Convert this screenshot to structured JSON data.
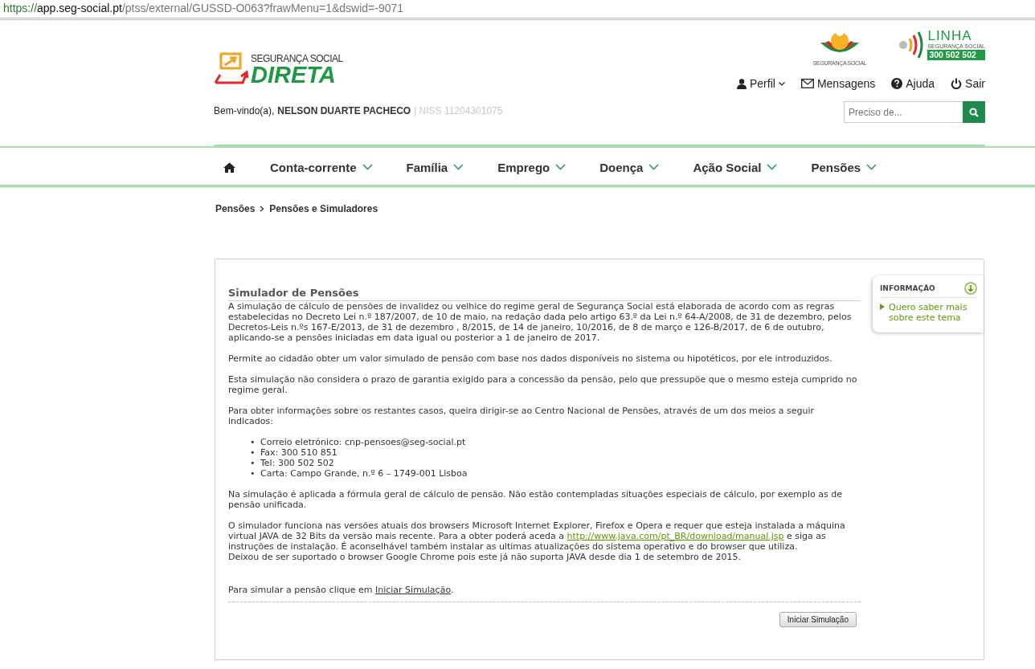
{
  "address_bar": {
    "scheme": "https://",
    "host": "app.seg-social.pt",
    "path": "/ptss/external/GUSSD-O063?frawMenu=1&dswid=-9071"
  },
  "header": {
    "logo": {
      "line1": "SEGURANÇA SOCIAL",
      "line2": "DIRETA"
    },
    "brand_logos": [
      {
        "kind": "emblem",
        "caption": "SEGURANÇA SOCIAL"
      },
      {
        "kind": "phone_line",
        "title": "LINHA",
        "subtitle": "SEGURANÇA SOCIAL",
        "number": "300 502 502"
      }
    ],
    "user_menu": [
      {
        "kind": "profile",
        "label": "Perfil",
        "dropdown": true
      },
      {
        "kind": "messages",
        "label": "Mensagens",
        "dropdown": false
      },
      {
        "kind": "help",
        "label": "Ajuda",
        "dropdown": false
      },
      {
        "kind": "logout",
        "label": "Sair",
        "dropdown": false
      }
    ],
    "welcome": {
      "greeting": "Bem-vindo(a),",
      "name": "NELSON DUARTE PACHECO",
      "niss": "| NISS 11204301075"
    },
    "search": {
      "placeholder": "Preciso de..."
    }
  },
  "nav": {
    "items": [
      {
        "label": "Conta-corrente"
      },
      {
        "label": "Família"
      },
      {
        "label": "Emprego"
      },
      {
        "label": "Doença"
      },
      {
        "label": "Ação Social"
      },
      {
        "label": "Pensões"
      }
    ]
  },
  "breadcrumb": [
    "Pensões",
    "Pensões e Simuladores"
  ],
  "content": {
    "title": "Simulador de Pensões",
    "blocks": [
      {
        "kind": "paragraph",
        "parts": [
          {
            "kind": "text",
            "text": "A simulação de cálculo de pensões de invalidez ou velhice do regime geral de Segurança Social está elaborada de acordo com as regras estabelecidas no Decreto Lei n.º 187/2007, de 10 de maio, na redação dada pelo artigo 63.º da Lei n.º 64-A/2008, de 31 de dezembro, pelos Decretos-Leis n.ºs 167-E/2013, de 31 de dezembro , 8/2015, de 14 de janeiro, 10/2016, de 8 de março e 126-B/2017, de 6 de outubro, aplicando-se a pensões iniciadas em data igual ou posterior a 1 de janeiro de 2017."
          }
        ]
      },
      {
        "kind": "paragraph",
        "parts": [
          {
            "kind": "text",
            "text": "Permite ao cidadão obter um valor simulado de pensão com base nos dados disponíveis no sistema ou hipotéticos, por ele introduzidos."
          }
        ]
      },
      {
        "kind": "paragraph",
        "parts": [
          {
            "kind": "text",
            "text": "Esta simulação não considera o prazo de garantia exigido para a concessão da pensão, pelo que pressupõe que o mesmo esteja cumprido no regime geral."
          }
        ]
      },
      {
        "kind": "paragraph",
        "parts": [
          {
            "kind": "text",
            "text": "Para obter informações sobre os restantes casos, queira dirigir-se ao Centro Nacional de Pensões, através de um dos meios a seguir indicados:"
          }
        ]
      },
      {
        "kind": "list",
        "items": [
          {
            "bullet": "•",
            "text": "Correio eletrónico: cnp-pensoes@seg-social.pt"
          },
          {
            "bullet": "•",
            "text": "Fax: 300 510 851"
          },
          {
            "bullet": "•",
            "text": "Tel: 300 502 502"
          },
          {
            "bullet": "•",
            "text": "Carta: Campo Grande, n.º 6 – 1749-001 Lisboa"
          }
        ]
      },
      {
        "kind": "paragraph",
        "parts": [
          {
            "kind": "text",
            "text": "Na simulação é aplicada a fórmula geral de cálculo de pensão. Não estão contempladas situações especiais de cálculo, por exemplo as de pensão unificada."
          }
        ]
      },
      {
        "kind": "paragraph",
        "parts": [
          {
            "kind": "text",
            "text": "O simulador funciona nas versões atuais dos browsers Microsoft Internet Explorer, Firefox e Opera e requer que esteja instalada a máquina virtual JAVA de 32 Bits da versão mais recente. Para a obter poderá aceda a "
          },
          {
            "kind": "link",
            "text": "http://www.java.com/pt_BR/download/manual.jsp"
          },
          {
            "kind": "text",
            "text": " e siga as instruções de instalação. É aconselhável também instalar as ultimas atualizações do sistema operativo e do browser que utiliza."
          }
        ]
      },
      {
        "kind": "continuation",
        "parts": [
          {
            "kind": "text",
            "text": "Deixou de ser suportado o browser Google Chrome pois este já não suporta JAVA desde dia 1 de setembro de 2015."
          }
        ]
      },
      {
        "kind": "final",
        "parts": [
          {
            "kind": "text",
            "text": "Para simular a pensão clique em "
          },
          {
            "kind": "anchor",
            "text": "Iniciar Simulação"
          },
          {
            "kind": "text",
            "text": "."
          }
        ]
      }
    ],
    "button": "Iniciar Simulação"
  },
  "info_panel": {
    "title": "INFORMAÇÃO",
    "link": "Quero saber mais sobre este tema"
  }
}
